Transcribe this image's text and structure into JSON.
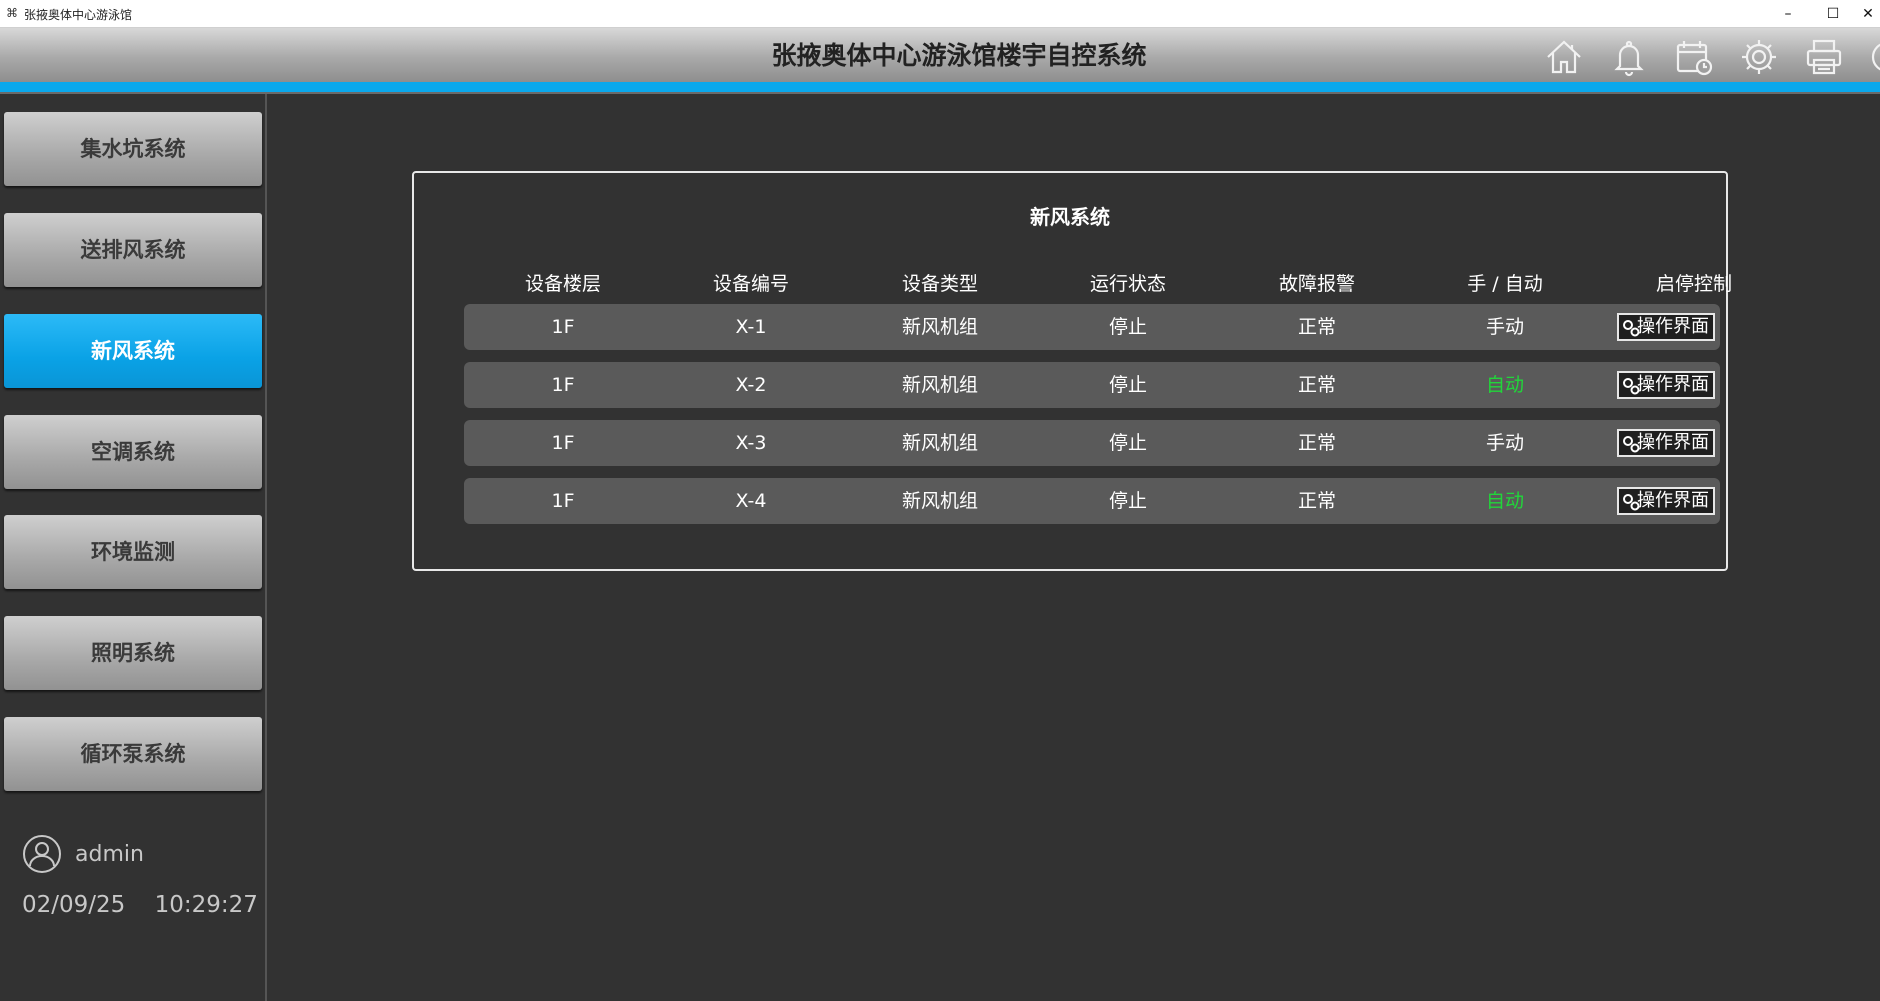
{
  "window": {
    "title": "张掖奥体中心游泳馆",
    "minimize": "–",
    "maximize": "☐",
    "close": "✕"
  },
  "header": {
    "title": "张掖奥体中心游泳馆楼宇自控系统",
    "icons": [
      "home-icon",
      "bell-icon",
      "calendar-icon",
      "gear-icon",
      "printer-icon",
      "power-icon"
    ]
  },
  "colors": {
    "accent": "#0aa8ec",
    "auto_green": "#21d63a",
    "background": "#323232",
    "row": "#5a5a5a"
  },
  "sidebar": {
    "items": [
      {
        "label": "集水坑系统",
        "active": false
      },
      {
        "label": "送排风系统",
        "active": false
      },
      {
        "label": "新风系统",
        "active": true
      },
      {
        "label": "空调系统",
        "active": false
      },
      {
        "label": "环境监测",
        "active": false
      },
      {
        "label": "照明系统",
        "active": false
      },
      {
        "label": "循环泵系统",
        "active": false
      }
    ],
    "user": "admin",
    "date": "02/09/25",
    "time": "10:29:27"
  },
  "panel": {
    "title": "新风系统",
    "columns": [
      "设备楼层",
      "设备编号",
      "设备类型",
      "运行状态",
      "故障报警",
      "手 / 自动",
      "启停控制"
    ],
    "rows": [
      {
        "floor": "1F",
        "id": "X-1",
        "type": "新风机组",
        "status": "停止",
        "alarm": "正常",
        "mode": "手动",
        "control": "操作界面"
      },
      {
        "floor": "1F",
        "id": "X-2",
        "type": "新风机组",
        "status": "停止",
        "alarm": "正常",
        "mode": "自动",
        "control": "操作界面"
      },
      {
        "floor": "1F",
        "id": "X-3",
        "type": "新风机组",
        "status": "停止",
        "alarm": "正常",
        "mode": "手动",
        "control": "操作界面"
      },
      {
        "floor": "1F",
        "id": "X-4",
        "type": "新风机组",
        "status": "停止",
        "alarm": "正常",
        "mode": "自动",
        "control": "操作界面"
      }
    ]
  }
}
